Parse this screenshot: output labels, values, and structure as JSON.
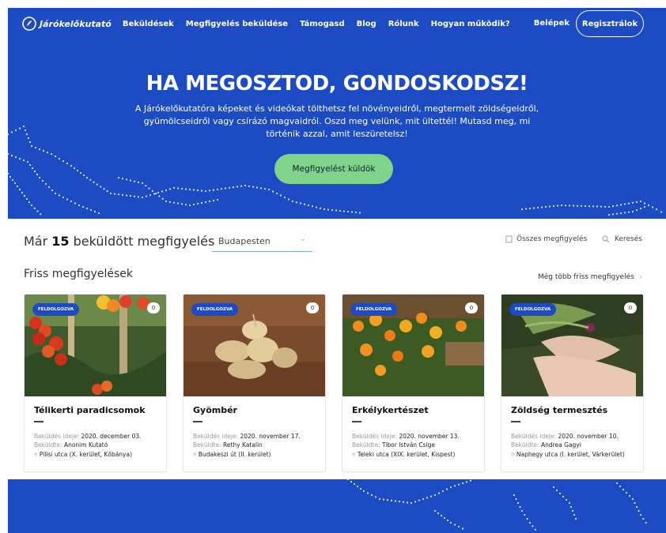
{
  "brand": {
    "name": "Járókelőkutató"
  },
  "nav": {
    "items": [
      "Beküldések",
      "Megfigyelés beküldése",
      "Támogasd",
      "Blog",
      "Rólunk",
      "Hogyan működik?"
    ],
    "login": "Belépek",
    "register": "Regisztrálok"
  },
  "hero": {
    "title": "HA MEGOSZTOD, GONDOSKODSZ!",
    "text": "A Járókelőkutatóra képeket és videókat tölthetsz fel növényeidről, megtermelt zöldségeidről, gyümölcseidről vagy csírázó magvaidról. Oszd meg velünk, mit ültettél! Mutasd meg, mi történik azzal, amit leszüretelsz!",
    "cta": "Megfigyelést küldök"
  },
  "stats": {
    "prefix": "Már",
    "count": "15",
    "suffix": "beküldött megfigyelés",
    "city": "Budapesten",
    "all_label": "Összes megfigyelés",
    "search_label": "Keresés"
  },
  "recent": {
    "title": "Friss megfigyelések",
    "more": "Még több friss megfigyelés"
  },
  "colors": {
    "brand": "#1c4bc4",
    "cta": "#7fd38a"
  },
  "cards": [
    {
      "badge": "FELDOLGOZVA",
      "count": "0",
      "title": "Télikerti paradicsomok",
      "date_label": "Beküldés ideje:",
      "date": "2020. december 03.",
      "by_label": "Beküldte:",
      "by": "Anonim Kutató",
      "location": "Pilisi utca (X. kerület, Kőbánya)"
    },
    {
      "badge": "FELDOLGOZVA",
      "count": "0",
      "title": "Gyömbér",
      "date_label": "Beküldés ideje:",
      "date": "2020. november 17.",
      "by_label": "Beküldte:",
      "by": "Rethy Katalin",
      "location": "Budakeszi út (II. kerület)"
    },
    {
      "badge": "FELDOLGOZVA",
      "count": "0",
      "title": "Erkélykertészet",
      "date_label": "Beküldés ideje:",
      "date": "2020. november 13.",
      "by_label": "Beküldte:",
      "by": "Tibor István Csige",
      "location": "Teleki utca (XIX. kerület, Kispest)"
    },
    {
      "badge": "FELDOLGOZVA",
      "count": "0",
      "title": "Zöldség termesztés",
      "date_label": "Beküldés ideje:",
      "date": "2020. november 10.",
      "by_label": "Beküldte:",
      "by": "Andrea Gagyi",
      "location": "Naphegy utca (I. kerület, Várkerület)"
    }
  ]
}
